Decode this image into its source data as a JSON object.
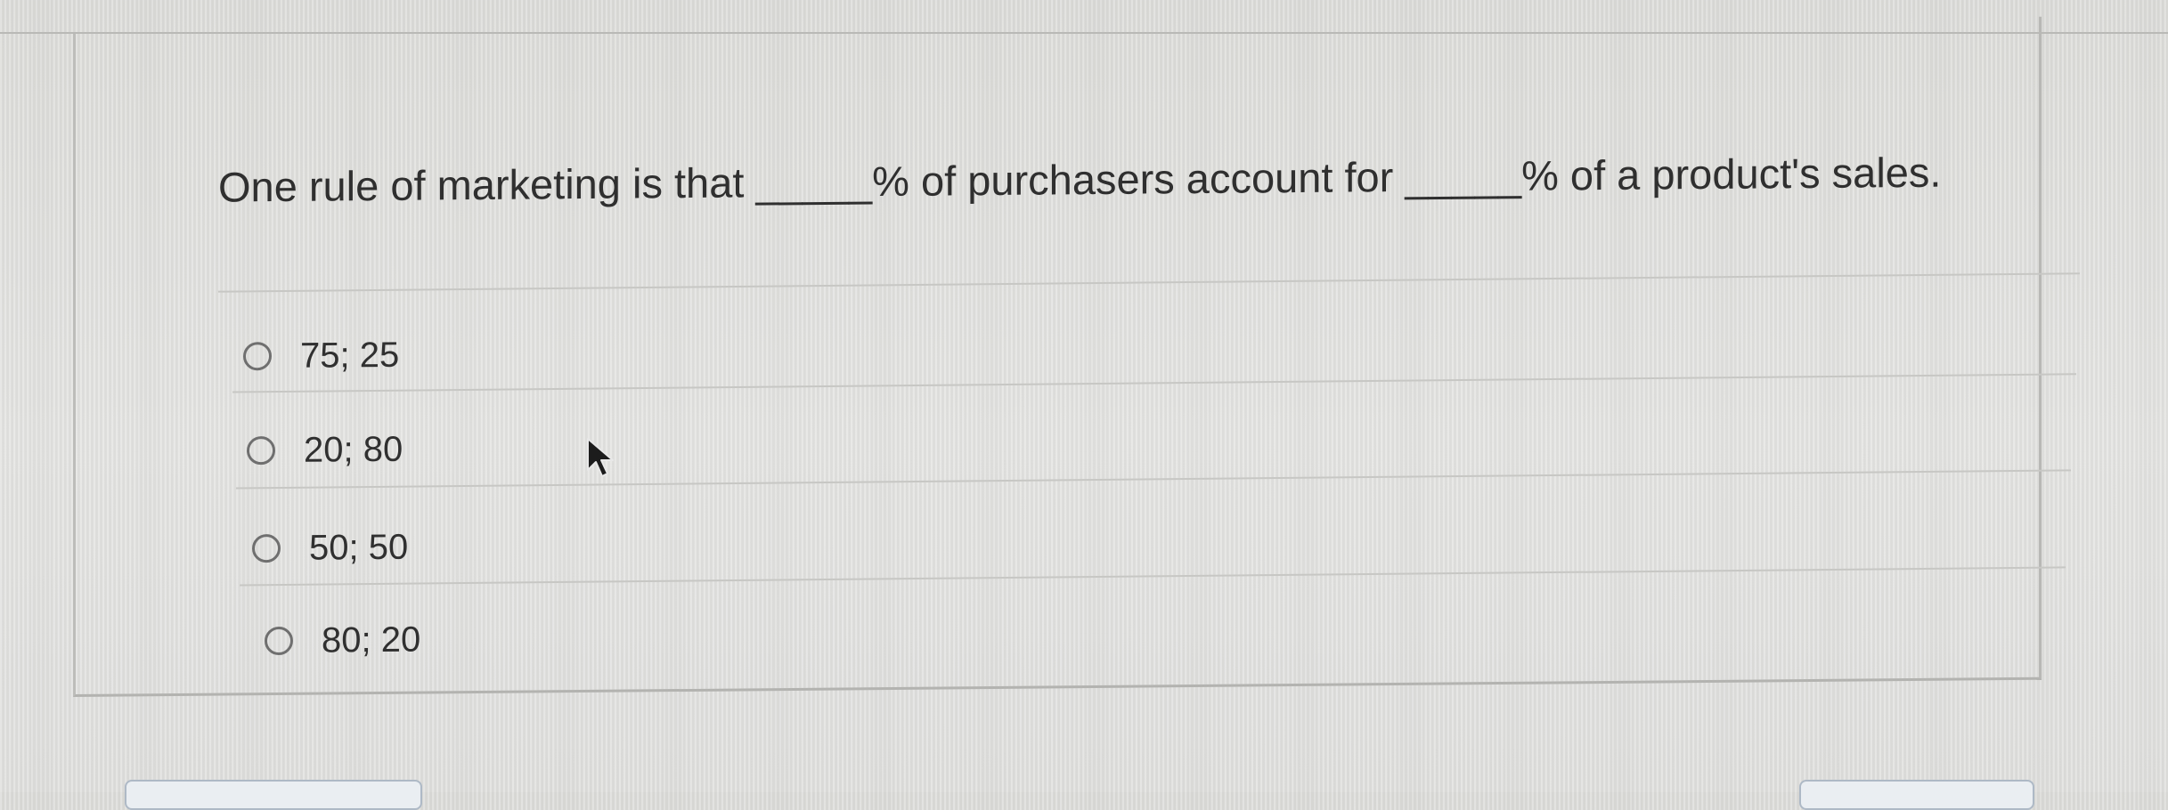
{
  "question": {
    "text": "One rule of marketing is that _____% of purchasers account for _____% of a product's sales."
  },
  "options": [
    {
      "label": "75; 25",
      "selected": false
    },
    {
      "label": "20; 80",
      "selected": false
    },
    {
      "label": "50; 50",
      "selected": false
    },
    {
      "label": "80; 20",
      "selected": false
    }
  ],
  "icons": {
    "radio": "radio-unchecked-icon",
    "cursor": "mouse-pointer-icon"
  },
  "colors": {
    "background": "#e2e2e0",
    "text": "#303030",
    "border": "#b9b9b6",
    "radio_border": "#6f6f6f"
  }
}
